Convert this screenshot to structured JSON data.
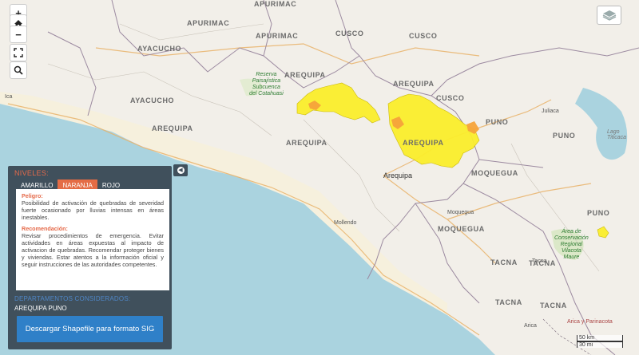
{
  "map": {
    "regions": {
      "apurimac_top": "APURIMAC",
      "apurimac": "APURIMAC",
      "apurimac_left": "APURIMAC",
      "cusco": "CUSCO",
      "cusco2": "CUSCO",
      "cusco3": "CUSCO",
      "ayacucho": "AYACUCHO",
      "ayacucho2": "AYACUCHO",
      "arequipa1": "AREQUIPA",
      "arequipa2": "AREQUIPA",
      "arequipa3": "AREQUIPA",
      "arequipa4": "AREQUIPA",
      "arequipa5": "AREQUIPA",
      "puno": "PUNO",
      "puno2": "PUNO",
      "puno3": "PUNO",
      "moquegua": "MOQUEGUA",
      "moquegua2": "MOQUEGUA",
      "tacna": "TACNA",
      "tacna2": "TACNA",
      "tacna3": "TACNA",
      "tacna4": "TACNA"
    },
    "cities": {
      "arequipa": "Arequipa",
      "juliaca": "Juliaca",
      "moquegua": "Moquegua",
      "mollendo": "Mollendo",
      "tacna": "Tacna",
      "arica": "Arica",
      "ica": "Ica"
    },
    "parks": {
      "cotahuasi": "Reserva\nPaisajística\nSubcuenca\ndel Cotahuasi",
      "vilacota": "Área de\nConservación\nRegional\nVilacota\nMaure"
    },
    "other": {
      "arica_parinacota": "Arica y Parinacota",
      "lago": "Lago\nTiticaca"
    },
    "overlay_colors": {
      "amarillo": "#fbee2c",
      "naranja": "#f6a33b",
      "border": "#b8a000"
    }
  },
  "toolbar": {
    "zoom_in": "+",
    "home_icon": "home-icon",
    "zoom_out": "−",
    "fullscreen_icon": "fullscreen-icon",
    "search_icon": "search-icon",
    "layers_icon": "layers-icon"
  },
  "panel": {
    "title": "NIVELES:",
    "tabs": [
      "AMARILLO",
      "NARANJA",
      "ROJO"
    ],
    "active_tab": "NARANJA",
    "peligro_label": "Peligro:",
    "peligro_text": "Posibilidad de activación de quebradas de severidad fuerte ocasionado por lluvias intensas en áreas inestables.",
    "recomendacion_label": "Recomendación:",
    "recomendacion_text": "Revisar procedimientos de emergencia. Evitar actividades en áreas expuestas al impacto de activacion de quebradas. Recomendar proteger bienes y viviendas. Estar atentos a la información oficial y seguir instrucciones de las autoridades competentes.",
    "departments_title": "DEPARTAMENTOS CONSIDERADOS:",
    "departments": "AREQUIPA  PUNO",
    "download_button": "Descargar Shapefile para formato SIG",
    "accent_color": "#e46c45"
  },
  "scale": {
    "km": "50 km",
    "mi": "30 mi"
  }
}
